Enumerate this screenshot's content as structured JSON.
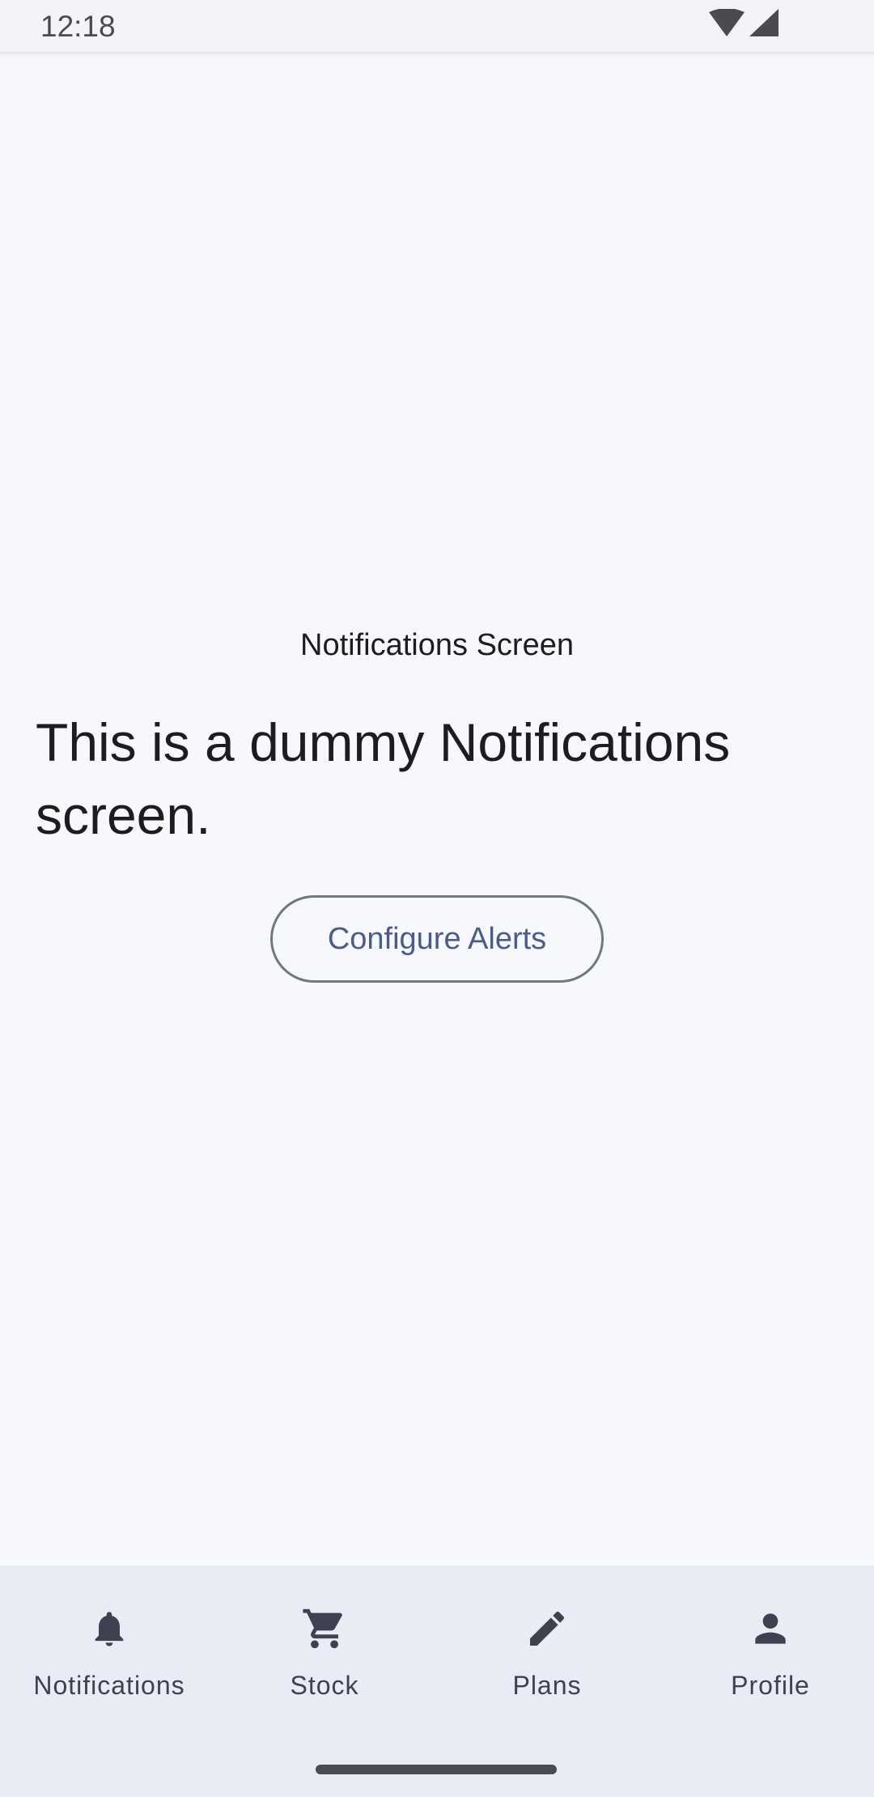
{
  "status_bar": {
    "time": "12:18",
    "icons": [
      "wifi-icon",
      "cellular-signal-icon"
    ]
  },
  "main": {
    "title": "Notifications Screen",
    "body": "This is a dummy Notifications screen.",
    "configure_button_label": "Configure Alerts"
  },
  "bottom_nav": {
    "items": [
      {
        "label": "Notifications",
        "icon": "bell-icon"
      },
      {
        "label": "Stock",
        "icon": "cart-icon"
      },
      {
        "label": "Plans",
        "icon": "pencil-icon"
      },
      {
        "label": "Profile",
        "icon": "person-icon"
      }
    ]
  },
  "colors": {
    "background": "#f7f8fc",
    "nav_background": "#e9ebf5",
    "button_text": "#4a5c8e",
    "icon": "#3e4150"
  }
}
